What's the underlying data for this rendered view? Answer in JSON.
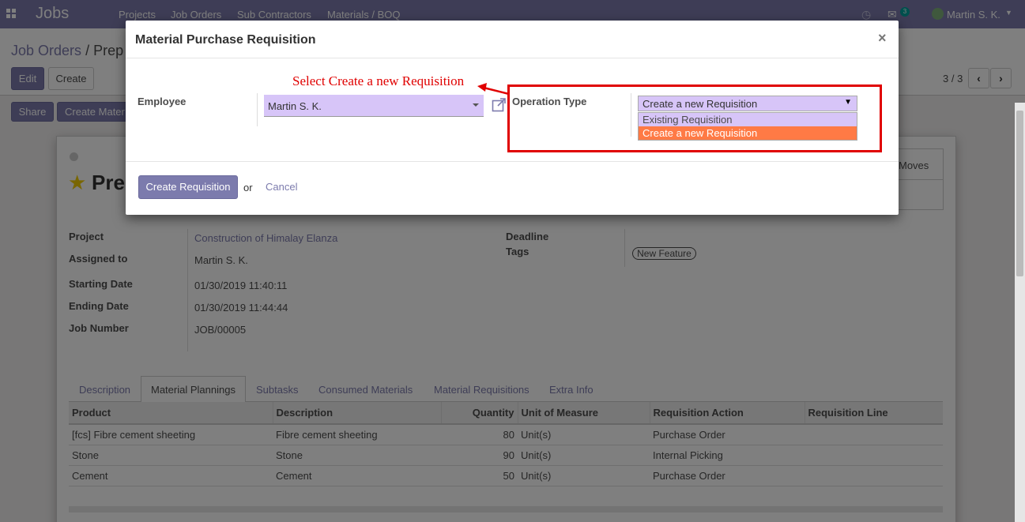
{
  "navbar": {
    "brand": "Jobs",
    "menu": [
      "Projects",
      "Job Orders",
      "Sub Contractors",
      "Materials / BOQ"
    ],
    "chat_badge": "3",
    "user": "Martin S. K.",
    "icons": [
      "apps-grid-icon",
      "clock-icon",
      "chat-icon",
      "avatar-icon",
      "caret-down-icon"
    ]
  },
  "breadcrumb": {
    "parent": "Job Orders",
    "separator": "/",
    "current": "Prep"
  },
  "buttons": {
    "edit": "Edit",
    "create": "Create",
    "share": "Share",
    "create_material": "Create Mater"
  },
  "pager": {
    "text": "3 / 3",
    "prev": "‹",
    "next": "›"
  },
  "record": {
    "title": "Pre",
    "smart_button": "Moves",
    "fields": {
      "project_label": "Project",
      "project": "Construction of Himalay Elanza",
      "assigned_label": "Assigned to",
      "assigned": "Martin S. K.",
      "start_label": "Starting Date",
      "start": "01/30/2019 11:40:11",
      "end_label": "Ending Date",
      "end": "01/30/2019 11:44:44",
      "job_label": "Job Number",
      "job": "JOB/00005",
      "deadline_label": "Deadline",
      "tags_label": "Tags",
      "tag": "New Feature"
    },
    "tabs": [
      "Description",
      "Material Plannings",
      "Subtasks",
      "Consumed Materials",
      "Material Requisitions",
      "Extra Info"
    ],
    "active_tab": "Material Plannings",
    "table": {
      "headers": [
        "Product",
        "Description",
        "Quantity",
        "Unit of Measure",
        "Requisition Action",
        "Requisition Line"
      ],
      "rows": [
        [
          "[fcs] Fibre cement sheeting",
          "Fibre cement sheeting",
          "80",
          "Unit(s)",
          "Purchase Order",
          ""
        ],
        [
          "Stone",
          "Stone",
          "90",
          "Unit(s)",
          "Internal Picking",
          ""
        ],
        [
          "Cement",
          "Cement",
          "50",
          "Unit(s)",
          "Purchase Order",
          ""
        ]
      ]
    }
  },
  "modal": {
    "title": "Material Purchase Requisition",
    "close": "×",
    "employee_label": "Employee",
    "employee_value": "Martin S. K.",
    "operation_label": "Operation Type",
    "operation_value": "Create a new Requisition",
    "select_arrow": "▼",
    "options": [
      "Existing Requisition",
      "Create a new Requisition"
    ],
    "annotation": "Select Create a new Requisition",
    "create_button": "Create Requisition",
    "or": "or",
    "cancel": "Cancel"
  },
  "colors": {
    "brand": "#7c7bad",
    "field": "#d7c5f8",
    "highlight": "#ff7a45",
    "annotation": "#e00000"
  }
}
